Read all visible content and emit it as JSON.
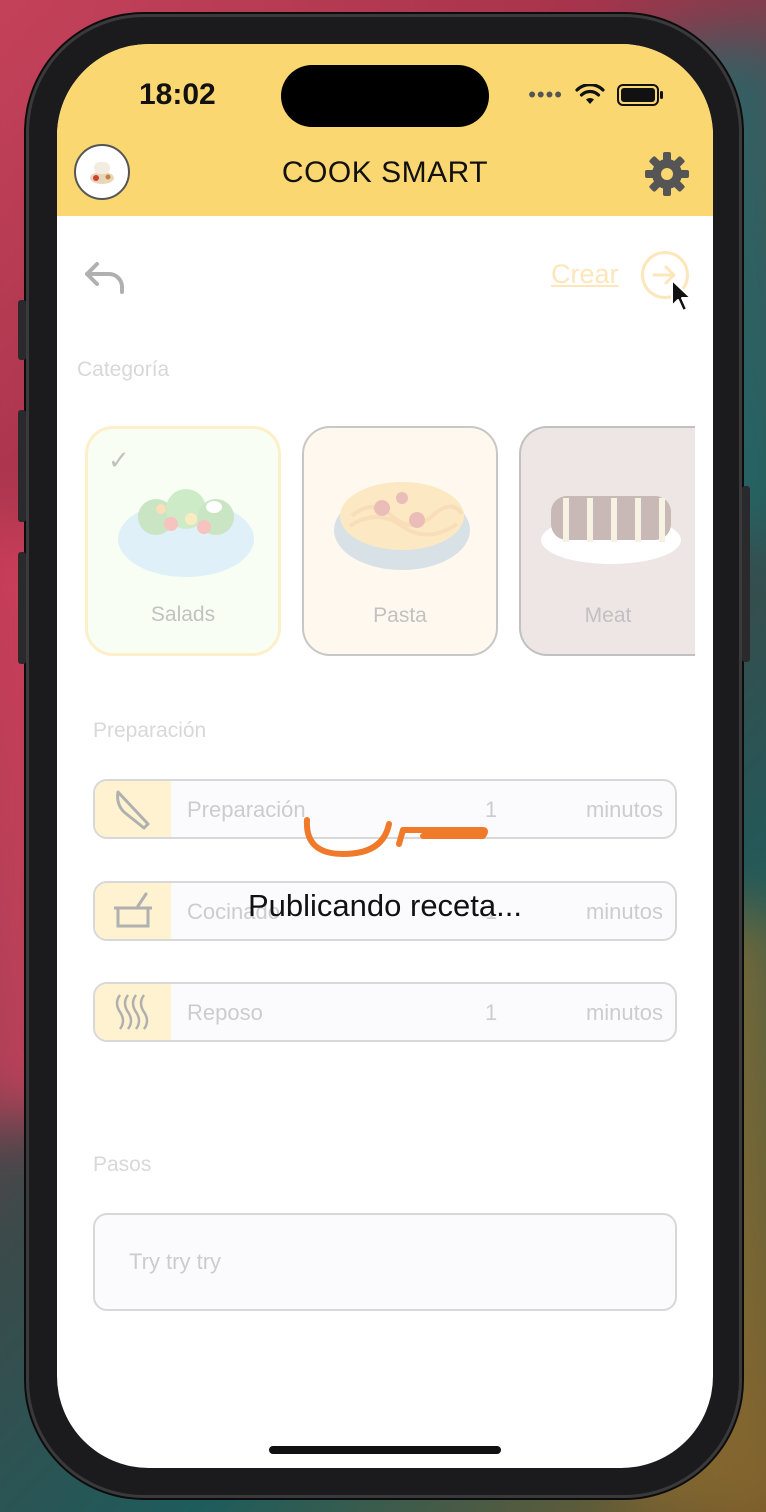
{
  "status_bar": {
    "time": "18:02"
  },
  "header": {
    "title": "COOK SMART",
    "avatar_icon": "chef-avatar-icon",
    "settings_icon": "gear-icon"
  },
  "toolbar": {
    "create_label": "Crear"
  },
  "categories": {
    "section_label": "Categoría",
    "items": [
      {
        "label": "Salads",
        "selected": true
      },
      {
        "label": "Pasta",
        "selected": false
      },
      {
        "label": "Meat",
        "selected": false
      }
    ]
  },
  "preparation": {
    "section_label": "Preparación",
    "fields": [
      {
        "label": "Preparación",
        "value": "1",
        "unit": "minutos",
        "icon": "knife-icon"
      },
      {
        "label": "Cocinado",
        "value": "1",
        "unit": "minutos",
        "icon": "pot-icon"
      },
      {
        "label": "Reposo",
        "value": "1",
        "unit": "minutos",
        "icon": "steam-icon"
      }
    ]
  },
  "steps": {
    "section_label": "Pasos",
    "placeholder": "Try try try"
  },
  "overlay": {
    "loading_text": "Publicando receta..."
  },
  "colors": {
    "accent": "#fbd772",
    "link": "#f5b430",
    "loader": "#f07a2a"
  }
}
